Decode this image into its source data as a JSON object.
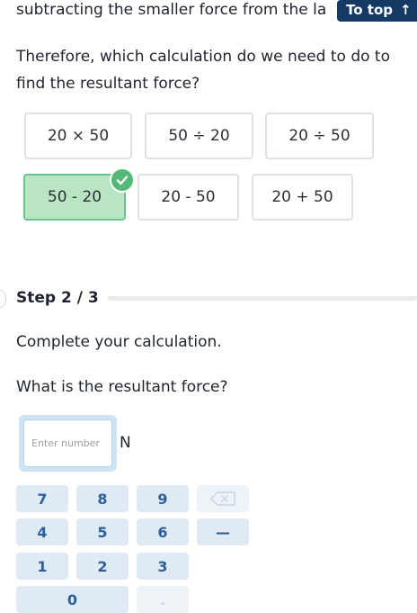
{
  "header": {
    "top_line": "subtracting the smaller force from the la",
    "to_top_label": "To top",
    "to_top_arrow": "↑"
  },
  "question": "Therefore, which calculation do we need to do to find the resultant force?",
  "options": [
    {
      "label": "20 × 50",
      "selected": false
    },
    {
      "label": "50 ÷ 20",
      "selected": false
    },
    {
      "label": "20 ÷ 50",
      "selected": false
    },
    {
      "label": "50 - 20",
      "selected": true
    },
    {
      "label": "20 - 50",
      "selected": false
    },
    {
      "label": "20 + 50",
      "selected": false
    }
  ],
  "step": {
    "label": "Step 2 / 3",
    "instruction": "Complete your calculation.",
    "prompt": "What is the resultant force?"
  },
  "answer": {
    "placeholder": "Enter number",
    "value": "",
    "unit": "N"
  },
  "keypad": {
    "keys": [
      "7",
      "8",
      "9",
      "4",
      "5",
      "6",
      "1",
      "2",
      "3",
      "0",
      "."
    ],
    "backspace_icon": "backspace-icon",
    "minus_label": "—"
  },
  "colors": {
    "to_top_bg": "#123a63",
    "selected_bg": "#b9e5c3",
    "check_green": "#54b878",
    "key_bg": "#dfeaf5",
    "key_text": "#2d5f9a"
  }
}
